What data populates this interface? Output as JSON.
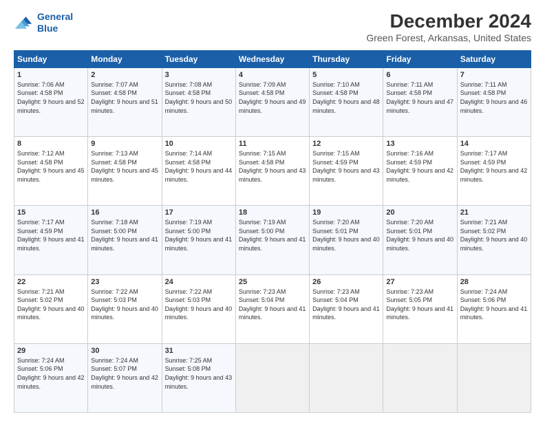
{
  "logo": {
    "line1": "General",
    "line2": "Blue"
  },
  "title": "December 2024",
  "subtitle": "Green Forest, Arkansas, United States",
  "days_header": [
    "Sunday",
    "Monday",
    "Tuesday",
    "Wednesday",
    "Thursday",
    "Friday",
    "Saturday"
  ],
  "weeks": [
    [
      {
        "day": "1",
        "sunrise": "7:06 AM",
        "sunset": "4:58 PM",
        "daylight": "9 hours and 52 minutes."
      },
      {
        "day": "2",
        "sunrise": "7:07 AM",
        "sunset": "4:58 PM",
        "daylight": "9 hours and 51 minutes."
      },
      {
        "day": "3",
        "sunrise": "7:08 AM",
        "sunset": "4:58 PM",
        "daylight": "9 hours and 50 minutes."
      },
      {
        "day": "4",
        "sunrise": "7:09 AM",
        "sunset": "4:58 PM",
        "daylight": "9 hours and 49 minutes."
      },
      {
        "day": "5",
        "sunrise": "7:10 AM",
        "sunset": "4:58 PM",
        "daylight": "9 hours and 48 minutes."
      },
      {
        "day": "6",
        "sunrise": "7:11 AM",
        "sunset": "4:58 PM",
        "daylight": "9 hours and 47 minutes."
      },
      {
        "day": "7",
        "sunrise": "7:11 AM",
        "sunset": "4:58 PM",
        "daylight": "9 hours and 46 minutes."
      }
    ],
    [
      {
        "day": "8",
        "sunrise": "7:12 AM",
        "sunset": "4:58 PM",
        "daylight": "9 hours and 45 minutes."
      },
      {
        "day": "9",
        "sunrise": "7:13 AM",
        "sunset": "4:58 PM",
        "daylight": "9 hours and 45 minutes."
      },
      {
        "day": "10",
        "sunrise": "7:14 AM",
        "sunset": "4:58 PM",
        "daylight": "9 hours and 44 minutes."
      },
      {
        "day": "11",
        "sunrise": "7:15 AM",
        "sunset": "4:58 PM",
        "daylight": "9 hours and 43 minutes."
      },
      {
        "day": "12",
        "sunrise": "7:15 AM",
        "sunset": "4:59 PM",
        "daylight": "9 hours and 43 minutes."
      },
      {
        "day": "13",
        "sunrise": "7:16 AM",
        "sunset": "4:59 PM",
        "daylight": "9 hours and 42 minutes."
      },
      {
        "day": "14",
        "sunrise": "7:17 AM",
        "sunset": "4:59 PM",
        "daylight": "9 hours and 42 minutes."
      }
    ],
    [
      {
        "day": "15",
        "sunrise": "7:17 AM",
        "sunset": "4:59 PM",
        "daylight": "9 hours and 41 minutes."
      },
      {
        "day": "16",
        "sunrise": "7:18 AM",
        "sunset": "5:00 PM",
        "daylight": "9 hours and 41 minutes."
      },
      {
        "day": "17",
        "sunrise": "7:19 AM",
        "sunset": "5:00 PM",
        "daylight": "9 hours and 41 minutes."
      },
      {
        "day": "18",
        "sunrise": "7:19 AM",
        "sunset": "5:00 PM",
        "daylight": "9 hours and 41 minutes."
      },
      {
        "day": "19",
        "sunrise": "7:20 AM",
        "sunset": "5:01 PM",
        "daylight": "9 hours and 40 minutes."
      },
      {
        "day": "20",
        "sunrise": "7:20 AM",
        "sunset": "5:01 PM",
        "daylight": "9 hours and 40 minutes."
      },
      {
        "day": "21",
        "sunrise": "7:21 AM",
        "sunset": "5:02 PM",
        "daylight": "9 hours and 40 minutes."
      }
    ],
    [
      {
        "day": "22",
        "sunrise": "7:21 AM",
        "sunset": "5:02 PM",
        "daylight": "9 hours and 40 minutes."
      },
      {
        "day": "23",
        "sunrise": "7:22 AM",
        "sunset": "5:03 PM",
        "daylight": "9 hours and 40 minutes."
      },
      {
        "day": "24",
        "sunrise": "7:22 AM",
        "sunset": "5:03 PM",
        "daylight": "9 hours and 40 minutes."
      },
      {
        "day": "25",
        "sunrise": "7:23 AM",
        "sunset": "5:04 PM",
        "daylight": "9 hours and 41 minutes."
      },
      {
        "day": "26",
        "sunrise": "7:23 AM",
        "sunset": "5:04 PM",
        "daylight": "9 hours and 41 minutes."
      },
      {
        "day": "27",
        "sunrise": "7:23 AM",
        "sunset": "5:05 PM",
        "daylight": "9 hours and 41 minutes."
      },
      {
        "day": "28",
        "sunrise": "7:24 AM",
        "sunset": "5:06 PM",
        "daylight": "9 hours and 41 minutes."
      }
    ],
    [
      {
        "day": "29",
        "sunrise": "7:24 AM",
        "sunset": "5:06 PM",
        "daylight": "9 hours and 42 minutes."
      },
      {
        "day": "30",
        "sunrise": "7:24 AM",
        "sunset": "5:07 PM",
        "daylight": "9 hours and 42 minutes."
      },
      {
        "day": "31",
        "sunrise": "7:25 AM",
        "sunset": "5:08 PM",
        "daylight": "9 hours and 43 minutes."
      },
      null,
      null,
      null,
      null
    ]
  ],
  "labels": {
    "sunrise": "Sunrise:",
    "sunset": "Sunset:",
    "daylight": "Daylight:"
  }
}
